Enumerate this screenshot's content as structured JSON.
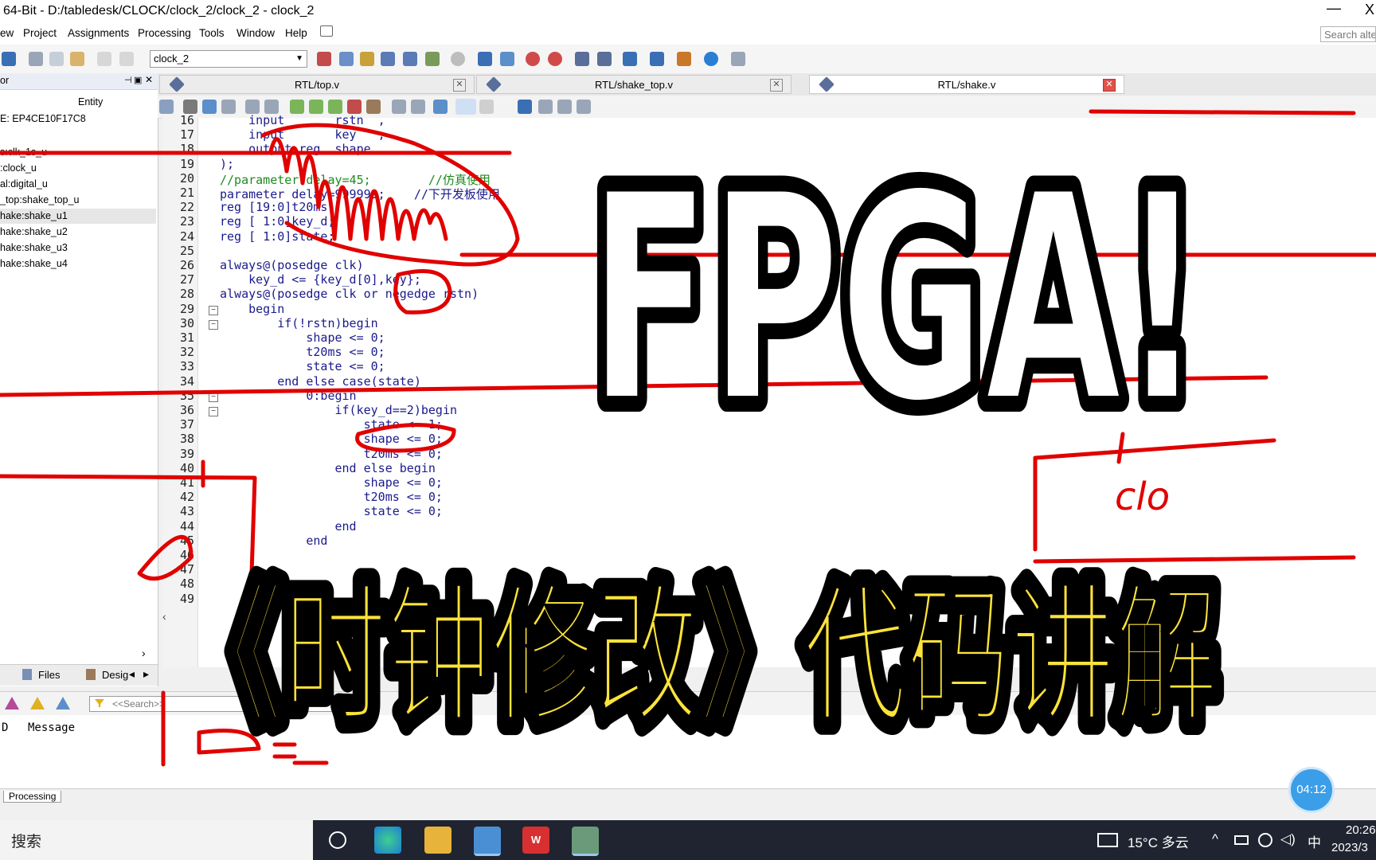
{
  "window": {
    "title": "64-Bit - D:/tabledesk/CLOCK/clock_2/clock_2 - clock_2",
    "min_glyph": "—",
    "close_glyph": "X"
  },
  "menu": {
    "items": [
      "ew",
      "Project",
      "Assignments",
      "Processing",
      "Tools",
      "Window",
      "Help"
    ],
    "search_placeholder": "Search alte"
  },
  "toolbar": {
    "project": "clock_2"
  },
  "hierarchy": {
    "title": "or",
    "entity_header": "Entity",
    "device": "E: EP4CE10F17C8",
    "rows": [
      "s:clk_1s_u",
      ":clock_u",
      "al:digital_u",
      "_top:shake_top_u",
      "hake:shake_u1",
      "hake:shake_u2",
      "hake:shake_u3",
      "hake:shake_u4"
    ]
  },
  "panel_tabs": {
    "files": "Files",
    "design": "Desig"
  },
  "tabs": [
    {
      "label": "RTL/top.v",
      "active": false
    },
    {
      "label": "RTL/shake_top.v",
      "active": false
    },
    {
      "label": "RTL/shake.v",
      "active": true
    }
  ],
  "editor": {
    "line_numbers": [
      "16",
      "17",
      "18",
      "19",
      "20",
      "21",
      "22",
      "23",
      "24",
      "25",
      "26",
      "27",
      "28",
      "29",
      "30",
      "31",
      "32",
      "33",
      "34",
      "35",
      "36",
      "37",
      "38",
      "39",
      "40",
      "41",
      "42",
      "43",
      "44",
      "45",
      "46",
      "47",
      "48",
      "49"
    ],
    "lines": [
      "    input       rstn  ,",
      "    input       key   ,",
      "    output reg  shape",
      ");",
      "//parameter delay=45;        //仿真使用",
      "parameter delay=999999;    //下开发板使用",
      "reg [19:0]t20ms;",
      "reg [ 1:0]key_d;",
      "reg [ 1:0]state;",
      "",
      "always@(posedge clk)",
      "    key_d <= {key_d[0],key};",
      "always@(posedge clk or negedge rstn)",
      "    begin",
      "        if(!rstn)begin",
      "            shape <= 0;",
      "            t20ms <= 0;",
      "            state <= 0;",
      "        end else case(state)",
      "            0:begin",
      "                if(key_d==2)begin",
      "                    state <= 1;",
      "                    shape <= 0;",
      "                    t20ms <= 0;",
      "                end else begin",
      "                    shape <= 0;",
      "                    t20ms <= 0;",
      "                    state <= 0;",
      "                end",
      "            end",
      "",
      "",
      "",
      ""
    ]
  },
  "messages": {
    "search_placeholder": "<<Search>>",
    "col_id": "D",
    "col_message": "Message",
    "status_tab": "Processing"
  },
  "overlay": {
    "headline": "FPGA!",
    "subtitle": "《时钟修改》代码讲解",
    "scribble": "clo",
    "timer": "04:12"
  },
  "taskbar": {
    "search": "搜索",
    "weather": "15°C  多云",
    "ime": "中",
    "time": "20:26",
    "date": "2023/3"
  },
  "colors": {
    "annotation_red": "#e00000",
    "title_yellow": "#fce33a",
    "timer_blue": "#3b9ee8"
  }
}
